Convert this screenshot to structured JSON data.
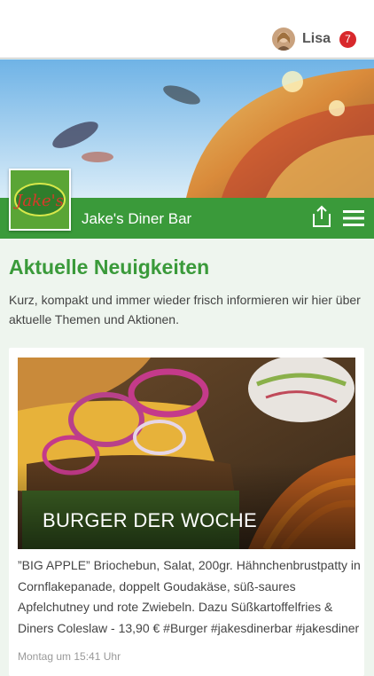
{
  "user": {
    "name": "Lisa",
    "notifications": "7"
  },
  "header": {
    "title": "Jake's Diner Bar",
    "logo_text": "Jake's"
  },
  "news": {
    "heading": "Aktuelle Neuigkeiten",
    "intro": "Kurz, kompakt und immer wieder frisch informieren wir hier über aktuelle Themen und Aktionen."
  },
  "post": {
    "title": "BURGER DER WOCHE",
    "text": "”BIG APPLE” Briochebun, Salat, 200gr. Hähnchenbrustpatty in Cornflakepanade, doppelt Goudakäse, süß-saures Apfelchutney und rote Zwiebeln. Dazu Süßkartoffelfries & Diners Coleslaw - 13,90 € #Burger #jakesdinerbar #jakesdiner",
    "date": "Montag um 15:41 Uhr"
  },
  "icons": [
    "avatar",
    "share-icon",
    "menu-icon"
  ],
  "colors": {
    "brand_green": "#3a9a3a",
    "badge_red": "#d8282c",
    "background": "#eef5ee"
  }
}
